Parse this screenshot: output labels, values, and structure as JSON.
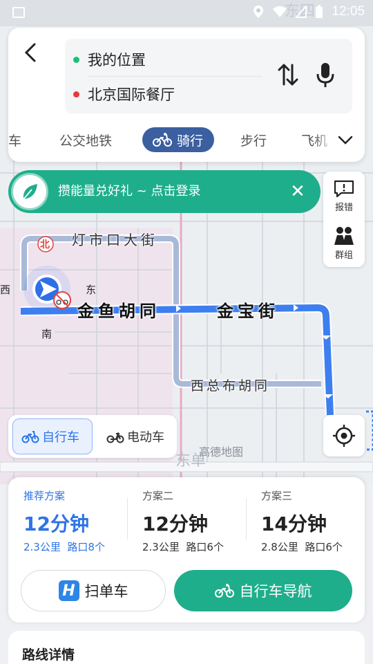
{
  "status_bar": {
    "time": "12:05"
  },
  "route": {
    "origin": "我的位置",
    "destination": "北京国际餐厅"
  },
  "mode_tabs": [
    {
      "label": "车",
      "active": false
    },
    {
      "label": "公交地铁",
      "active": false
    },
    {
      "label": "骑行",
      "active": true
    },
    {
      "label": "步行",
      "active": false
    },
    {
      "label": "飞机",
      "active": false
    }
  ],
  "banner": {
    "text": "攒能量兑好礼 ~ 点击登录",
    "close": "✕"
  },
  "side_tools": {
    "report": "报错",
    "group": "群组"
  },
  "map_labels": {
    "north_marker": "北",
    "road_dengshikou": "灯市口大街",
    "road_jinyu": "金鱼胡同",
    "road_jinbao": "金宝街",
    "road_xizongbu": "西总布胡同",
    "compass_east": "东",
    "compass_west": "西",
    "compass_south": "南",
    "district_dongdan": "东单",
    "district_dongsi": "东四",
    "watermark": "高德地图"
  },
  "vehicle_toggle": {
    "bike": "自行车",
    "ebike": "电动车",
    "selected": "bike"
  },
  "plans": [
    {
      "name": "推荐方案",
      "time": "12分钟",
      "distance": "2.3公里",
      "crossings": "路口8个",
      "active": true
    },
    {
      "name": "方案二",
      "time": "12分钟",
      "distance": "2.3公里",
      "crossings": "路口6个",
      "active": false
    },
    {
      "name": "方案三",
      "time": "14分钟",
      "distance": "2.8公里",
      "crossings": "路口6个",
      "active": false
    }
  ],
  "actions": {
    "scan": "扫单车",
    "scan_logo": "H",
    "navigate": "自行车导航"
  },
  "detail": {
    "title": "路线详情"
  },
  "colors": {
    "accent_blue": "#2d74e6",
    "accent_green": "#1fae8c",
    "tab_active": "#3b5f9f"
  }
}
